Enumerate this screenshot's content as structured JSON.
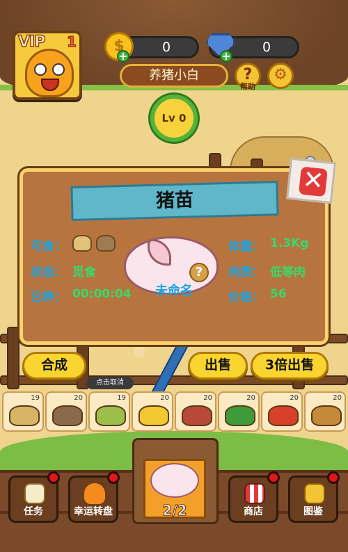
{
  "hud": {
    "vip_label": "VIP",
    "vip_level": "1",
    "gold": "0",
    "gems": "0",
    "player_name": "养猪小白",
    "help_icon": "?",
    "help_label": "帮助",
    "level": "Lv 0"
  },
  "panel": {
    "title": "猪苗",
    "close_icon": "✕",
    "food_label": "可食：",
    "status_label": "状态：",
    "status_value": "觅食",
    "raised_label": "已养：",
    "raised_value": "00:00:04",
    "weight_label": "体重：",
    "weight_value": "1.3Kg",
    "meat_label": "肉质：",
    "meat_value": "低等肉",
    "price_label": "价格：",
    "price_value": "56",
    "pig_name": "未命名",
    "pig_question": "?"
  },
  "actions": {
    "compose": "合成",
    "sell": "出售",
    "sell_triple": "3倍出售",
    "cancel_tip": "点击取消"
  },
  "foods": [
    {
      "name": "soybeans-icon",
      "count": "19",
      "color": "#d8b466"
    },
    {
      "name": "sunflower-seeds-icon",
      "count": "20",
      "color": "#8a6a4a"
    },
    {
      "name": "peas-icon",
      "count": "19",
      "color": "#9bbf4a"
    },
    {
      "name": "corn-icon",
      "count": "20",
      "color": "#f2c930"
    },
    {
      "name": "sweet-potato-icon",
      "count": "20",
      "color": "#b8483a"
    },
    {
      "name": "spinach-icon",
      "count": "20",
      "color": "#3f9a3a"
    },
    {
      "name": "vegetables-icon",
      "count": "20",
      "color": "#d8402a"
    },
    {
      "name": "ginseng-icon",
      "count": "20",
      "color": "#c48a3a"
    }
  ],
  "nav": {
    "task": "任务",
    "wheel": "幸运转盘",
    "pig_count": "2/2",
    "shop": "商店",
    "collection": "图鉴"
  }
}
